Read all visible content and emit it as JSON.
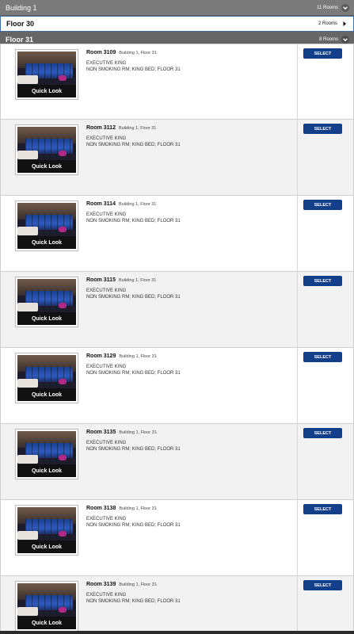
{
  "building": {
    "title": "Building 1",
    "count": "11 Rooms",
    "icon": "chevron-down-icon"
  },
  "floors": [
    {
      "title": "Floor 30",
      "count": "2 Rooms",
      "icon": "chevron-right-icon"
    },
    {
      "title": "Floor 31",
      "count": "8 Rooms",
      "icon": "chevron-down-icon"
    }
  ],
  "rooms": [
    {
      "name": "Room 3109",
      "location": "Building 1, Floor 31",
      "type": "EXECUTIVE KING",
      "details": "NON SMOKING RM; KING BED; FLOOR 31",
      "quick_look": "Quick Look",
      "select_label": "SELECT"
    },
    {
      "name": "Room 3112",
      "location": "Building 1, Floor 31",
      "type": "EXECUTIVE KING",
      "details": "NON SMOKING RM; KING BED; FLOOR 31",
      "quick_look": "Quick Look",
      "select_label": "SELECT"
    },
    {
      "name": "Room 3114",
      "location": "Building 1, Floor 31",
      "type": "EXECUTIVE KING",
      "details": "NON SMOKING RM; KING BED; FLOOR 31",
      "quick_look": "Quick Look",
      "select_label": "SELECT"
    },
    {
      "name": "Room 3115",
      "location": "Building 1, Floor 31",
      "type": "EXECUTIVE KING",
      "details": "NON SMOKING RM; KING BED; FLOOR 31",
      "quick_look": "Quick Look",
      "select_label": "SELECT"
    },
    {
      "name": "Room 3129",
      "location": "Building 1, Floor 31",
      "type": "EXECUTIVE KING",
      "details": "NON SMOKING RM; KING BED; FLOOR 31",
      "quick_look": "Quick Look",
      "select_label": "SELECT"
    },
    {
      "name": "Room 3135",
      "location": "Building 1, Floor 31",
      "type": "EXECUTIVE KING",
      "details": "NON SMOKING RM; KING BED; FLOOR 31",
      "quick_look": "Quick Look",
      "select_label": "SELECT"
    },
    {
      "name": "Room 3138",
      "location": "Building 1, Floor 31",
      "type": "EXECUTIVE KING",
      "details": "NON SMOKING RM; KING BED; FLOOR 31",
      "quick_look": "Quick Look",
      "select_label": "SELECT"
    },
    {
      "name": "Room 3139",
      "location": "Building 1, Floor 31",
      "type": "EXECUTIVE KING",
      "details": "NON SMOKING RM; KING BED; FLOOR 31",
      "quick_look": "Quick Look",
      "select_label": "SELECT"
    }
  ],
  "colors": {
    "header_gray": "#7a7a7a",
    "floor_active": "#666666",
    "select_button": "#123f8a",
    "row_alt": "#f2f2f2"
  }
}
